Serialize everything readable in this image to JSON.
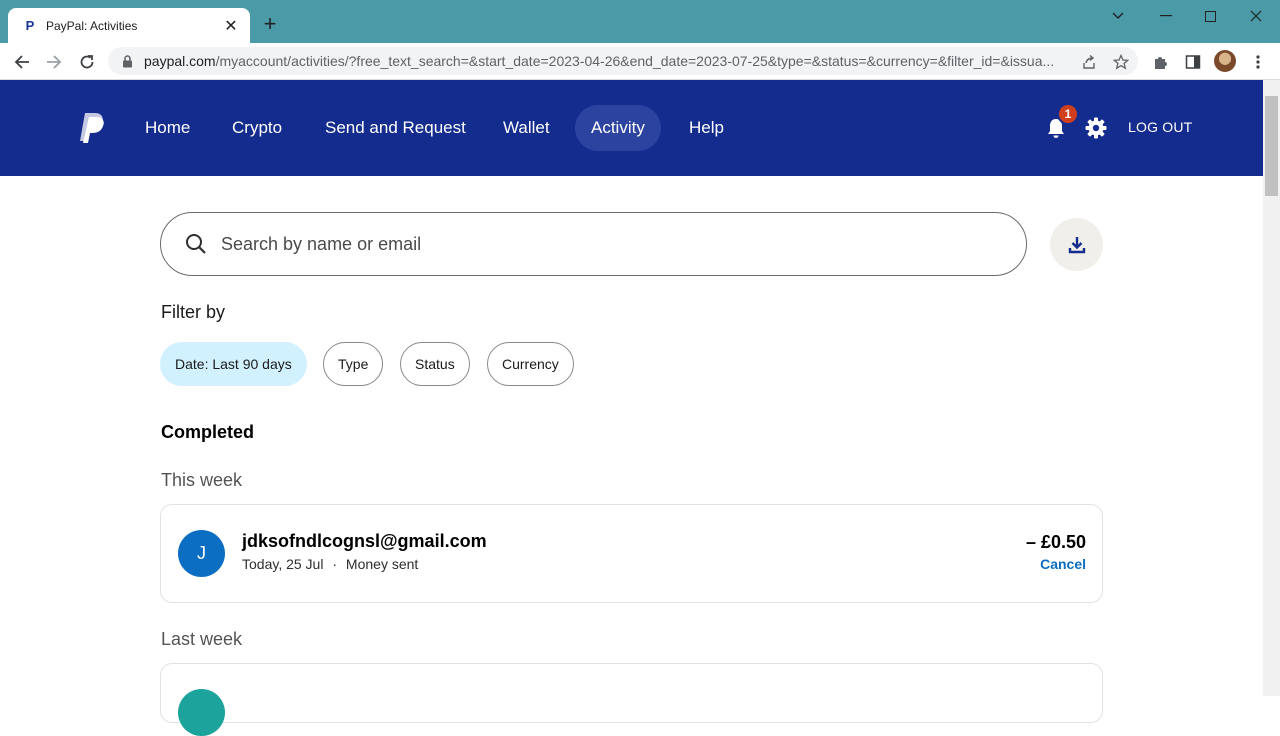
{
  "browser": {
    "tab_title": "PayPal: Activities",
    "tab_favicon": "P",
    "new_tab": "+",
    "url_host": "paypal.com",
    "url_rest": "/myaccount/activities/?free_text_search=&start_date=2023-04-26&end_date=2023-07-25&type=&status=&currency=&filter_id=&issua..."
  },
  "nav": {
    "items": [
      "Home",
      "Crypto",
      "Send and Request",
      "Wallet",
      "Activity",
      "Help"
    ],
    "active": "Activity",
    "notification_count": "1",
    "logout": "LOG OUT"
  },
  "search": {
    "placeholder": "Search by name or email"
  },
  "filters": {
    "label": "Filter by",
    "chips": [
      "Date: Last 90 days",
      "Type",
      "Status",
      "Currency"
    ]
  },
  "activity": {
    "section_title": "Completed",
    "groups": [
      {
        "label": "This week",
        "transactions": [
          {
            "initial": "J",
            "name": "jdksofndlcognsl@gmail.com",
            "date": "Today, 25 Jul",
            "separator": "·",
            "type": "Money sent",
            "amount": "– £0.50",
            "action": "Cancel"
          }
        ]
      },
      {
        "label": "Last week"
      }
    ]
  },
  "colors": {
    "nav_bg": "#142c8e",
    "nav_active": "#2d43a0",
    "chip_selected": "#d1f1ff",
    "link_blue": "#0b6ec2",
    "badge_red": "#d03f1d",
    "tabstrip": "#4a9ba7"
  }
}
